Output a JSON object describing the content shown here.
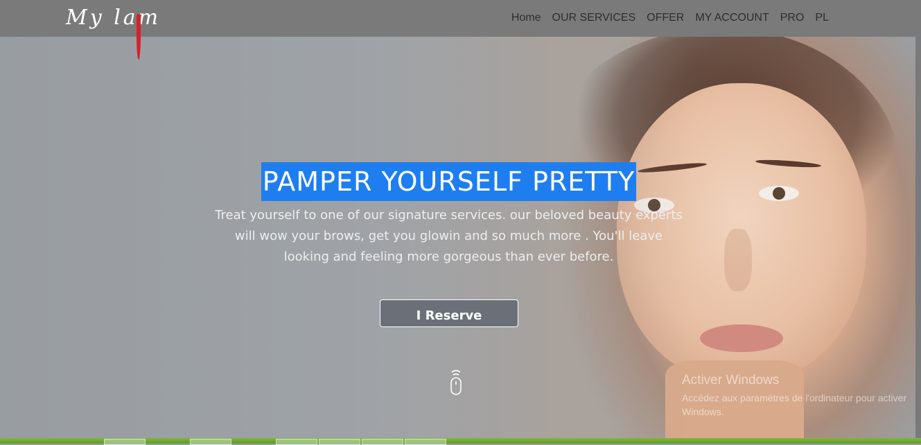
{
  "brand": {
    "logo_text": "My lam"
  },
  "nav": {
    "items": [
      "Home",
      "OUR SERVICES",
      "OFFER",
      "MY ACCOUNT",
      "PRO",
      "PL"
    ]
  },
  "hero": {
    "headline": "PAMPER YOURSELF PRETTY",
    "subtext": "Treat yourself to one of our signature services. our beloved beauty experts will wow your brows, get you glowin and so much more . You'll leave looking and feeling more gorgeous than ever before.",
    "cta_label": "I Reserve",
    "scroll_icon": "mouse-scroll-icon"
  },
  "os_watermark": {
    "title": "Activer Windows",
    "subtitle": "Accédez aux paramètres de l'ordinateur pour activer Windows."
  },
  "colors": {
    "navbar": "#7a7a7a",
    "headline_highlight": "#1e7ef0",
    "logo_accent": "#d4232c",
    "button_bg": "#6b7078"
  }
}
